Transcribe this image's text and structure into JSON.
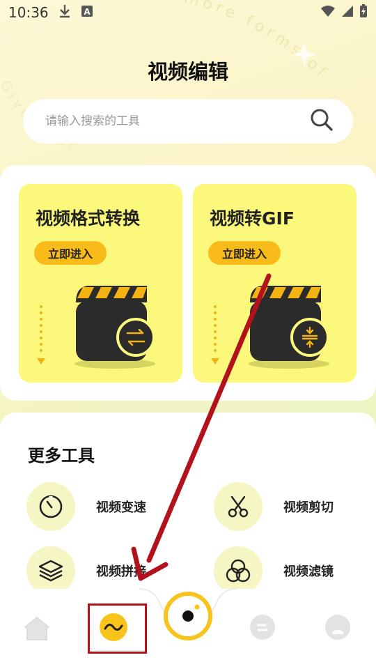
{
  "status_bar": {
    "time": "10:36",
    "icons": [
      "download-icon",
      "a-badge-icon",
      "wifi-icon",
      "signal-icon",
      "battery-charging-icon"
    ]
  },
  "decor": {
    "arc_text_1": "res more forms of",
    "arc_text_2": "Give your"
  },
  "header": {
    "title": "视频编辑"
  },
  "search": {
    "placeholder": "请输入搜索的工具",
    "icon": "search-icon"
  },
  "feature_cards": [
    {
      "title": "视频格式转换",
      "button": "立即进入",
      "badge_icon": "convert-arrows-icon"
    },
    {
      "title": "视频转GIF",
      "button": "立即进入",
      "badge_icon": "compress-arrows-icon"
    }
  ],
  "more_tools": {
    "title": "更多工具",
    "items": [
      {
        "label": "视频变速",
        "icon": "speed-timer-icon"
      },
      {
        "label": "视频剪切",
        "icon": "scissors-icon"
      },
      {
        "label": "视频拼接",
        "icon": "layers-icon"
      },
      {
        "label": "视频滤镜",
        "icon": "filter-circles-icon"
      }
    ]
  },
  "tab_bar": {
    "items": [
      {
        "name": "home",
        "icon": "home-icon",
        "active": false
      },
      {
        "name": "edit",
        "icon": "wave-icon",
        "active": true
      },
      {
        "name": "capture",
        "icon": "camera-ring-icon",
        "active": false
      },
      {
        "name": "menu",
        "icon": "menu-lines-icon",
        "active": false
      },
      {
        "name": "profile",
        "icon": "user-icon",
        "active": false
      }
    ]
  },
  "colors": {
    "accent_yellow": "#f8bb1a",
    "card_yellow": "#fbf87b",
    "annotation_red": "#b3121c",
    "text_dark": "#111111"
  }
}
